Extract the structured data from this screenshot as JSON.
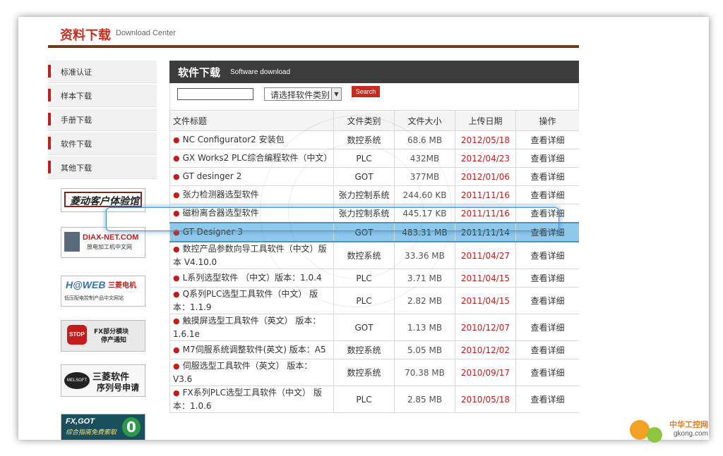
{
  "header": {
    "title_cn": "资料下载",
    "title_en": "Download Center"
  },
  "sidebar": {
    "items": [
      {
        "label": "标准认证"
      },
      {
        "label": "样本下载"
      },
      {
        "label": "手册下载"
      },
      {
        "label": "软件下载"
      },
      {
        "label": "其他下载"
      }
    ],
    "ads": [
      {
        "text": "菱动客户体验馆",
        "sub": ""
      },
      {
        "text": "DIAX-NET.COM",
        "sub": "放电加工机中文网"
      },
      {
        "text": "三菱电机",
        "sub": "低压配电控制产品中文网站"
      },
      {
        "text": "FX部分模块",
        "sub": "停产通知"
      },
      {
        "text": "三菱软件",
        "sub": "序列号申请"
      },
      {
        "text": "FX,GOT",
        "sub": "综合指南免费索取"
      }
    ]
  },
  "main": {
    "title_cn": "软件下载",
    "title_en": "Software download",
    "search": {
      "select_value": "请选择软件类别",
      "button_label": "Search"
    },
    "columns": [
      "文件标题",
      "文件类别",
      "文件大小",
      "上传日期",
      "操作"
    ],
    "rows": [
      {
        "title": "NC Configurator2 安装包",
        "cat": "数控系统",
        "size": "68.6 MB",
        "date": "2012/05/18",
        "op": "查看详细"
      },
      {
        "title": "GX Works2 PLC综合编程软件（中文）",
        "cat": "PLC",
        "size": "432MB",
        "date": "2012/04/23",
        "op": "查看详细"
      },
      {
        "title": "GT desinger 2",
        "cat": "GOT",
        "size": "377MB",
        "date": "2012/01/06",
        "op": "查看详细"
      },
      {
        "title": "张力检测器选型软件",
        "cat": "张力控制系统",
        "size": "244.60 KB",
        "date": "2011/11/16",
        "op": "查看详细"
      },
      {
        "title": "磁粉离合器选型软件",
        "cat": "张力控制系统",
        "size": "445.17 KB",
        "date": "2011/11/16",
        "op": "查看详细"
      },
      {
        "title": "GT Designer 3",
        "cat": "GOT",
        "size": "483.31 MB",
        "date": "2011/11/14",
        "op": "查看详细"
      },
      {
        "title": "数控产品参数向导工具软件（中文）版本 V4.10.0",
        "cat": "数控系统",
        "size": "33.36 MB",
        "date": "2011/04/27",
        "op": "查看详细"
      },
      {
        "title": "L系列选型软件 （中文）版本：1.0.4",
        "cat": "PLC",
        "size": "3.71 MB",
        "date": "2011/04/15",
        "op": "查看详细"
      },
      {
        "title": "Q系列PLC选型工具软件（中文） 版本：1.1.9",
        "cat": "PLC",
        "size": "2.82 MB",
        "date": "2011/04/15",
        "op": "查看详细"
      },
      {
        "title": "触摸屏选型工具软件（英文） 版本：1.6.1e",
        "cat": "GOT",
        "size": "1.13 MB",
        "date": "2010/12/07",
        "op": "查看详细"
      },
      {
        "title": "M7伺服系统调整软件(英文) 版本：A5",
        "cat": "数控系统",
        "size": "5.05 MB",
        "date": "2010/12/02",
        "op": "查看详细"
      },
      {
        "title": "伺服选型工具软件（英文） 版本：V3.6",
        "cat": "数控系统",
        "size": "70.38 MB",
        "date": "2010/09/17",
        "op": "查看详细"
      },
      {
        "title": "FX系列PLC选型工具软件（中文） 版本：1.0.6",
        "cat": "PLC",
        "size": "2.85 MB",
        "date": "2010/05/18",
        "op": "查看详细"
      }
    ]
  },
  "watermark": {
    "text1": "中华工控网",
    "text2": "gkong.com"
  }
}
